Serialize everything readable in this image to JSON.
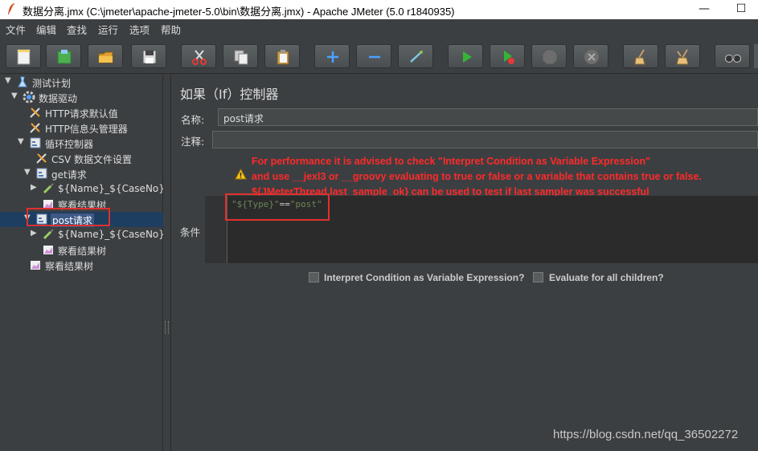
{
  "window": {
    "title": "数据分离.jmx (C:\\jmeter\\apache-jmeter-5.0\\bin\\数据分离.jmx) - Apache JMeter (5.0 r1840935)",
    "minimize_glyph": "—",
    "maximize_glyph": "☐"
  },
  "menu": [
    "文件",
    "编辑",
    "查找",
    "运行",
    "选项",
    "帮助"
  ],
  "toolbar": {
    "buttons": [
      "new-icon",
      "templates-icon",
      "open-icon",
      "save-icon",
      "cut-icon",
      "copy-icon",
      "paste-icon",
      "expand-icon",
      "collapse-icon",
      "toggle-icon",
      "start-icon",
      "start-no-pause-icon",
      "stop-icon",
      "shutdown-icon",
      "clear-icon",
      "clear-all-icon",
      "search-icon"
    ]
  },
  "tree": {
    "nodes": [
      {
        "label": "测试计划",
        "icon": "test-plan-icon"
      },
      {
        "label": "数据驱动",
        "icon": "thread-group-gear-icon"
      },
      {
        "label": "HTTP请求默认值",
        "icon": "config-wrench-icon"
      },
      {
        "label": "HTTP信息头管理器",
        "icon": "config-wrench-icon"
      },
      {
        "label": "循环控制器",
        "icon": "controller-icon"
      },
      {
        "label": "CSV 数据文件设置",
        "icon": "config-wrench-icon"
      },
      {
        "label": "get请求",
        "icon": "controller-icon"
      },
      {
        "label": "${Name}_${CaseNo}",
        "icon": "sampler-pipette-icon"
      },
      {
        "label": "察看结果树",
        "icon": "listener-chart-icon"
      },
      {
        "label": "post请求",
        "icon": "controller-icon"
      },
      {
        "label": "${Name}_${CaseNo}",
        "icon": "sampler-pipette-icon"
      },
      {
        "label": "察看结果树",
        "icon": "listener-chart-icon"
      },
      {
        "label": "察看结果树",
        "icon": "listener-chart-icon"
      }
    ]
  },
  "panel": {
    "title": "如果（If）控制器",
    "name_label": "名称:",
    "name_value": "post请求",
    "comment_label": "注释:",
    "warning_lines": [
      "For performance it is advised to check \"Interpret Condition as Variable Expression\"",
      "and use __jexl3 or __groovy evaluating to true or false or a variable that contains true or false.",
      "${JMeterThread.last_sample_ok} can be used to test if last sampler was successful"
    ],
    "condition_label": "条件",
    "condition_left": "\"${Type}\"",
    "condition_op": "==",
    "condition_right": "\"post\"",
    "checkbox_interpret": "Interpret Condition as Variable Expression?",
    "checkbox_children": "Evaluate for all children?"
  },
  "watermark": "https://blog.csdn.net/qq_36502272",
  "colors": {
    "background": "#3c3f41",
    "warning": "#ff2a2a",
    "highlight_box": "#e0302e",
    "selection": "#3d5a86"
  }
}
